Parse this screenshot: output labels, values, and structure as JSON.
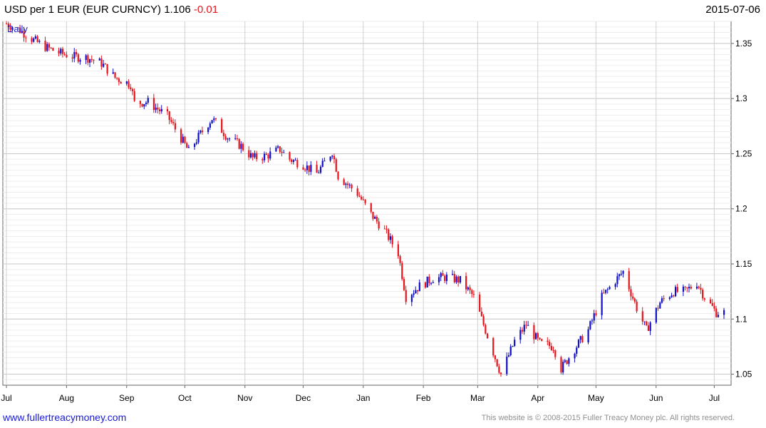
{
  "header": {
    "title": "USD per 1 EUR (EUR CURNCY) 1.106",
    "change": "-0.01",
    "date": "2015-07-06"
  },
  "footer": {
    "link": "www.fullertreacymoney.com",
    "copyright": "This website is © 2008-2015 Fuller Treacy Money plc. All rights reserved."
  },
  "colors": {
    "up": "#1010c8",
    "down": "#e8141c",
    "grid": "#dcdcdc",
    "axis": "#666666"
  },
  "chart_data": {
    "type": "candlestick",
    "period_label": "Daily",
    "ylim": [
      1.04,
      1.37
    ],
    "yticks": [
      1.05,
      1.1,
      1.15,
      1.2,
      1.25,
      1.3,
      1.35
    ],
    "ytick_labels": [
      "1.05",
      "1.1",
      "1.15",
      "1.2",
      "1.25",
      "1.3",
      "1.35"
    ],
    "xlim": [
      "2014-07-01",
      "2015-07-06"
    ],
    "months": [
      {
        "label": "Jul",
        "date": "2014-07-01"
      },
      {
        "label": "Aug",
        "date": "2014-08-01"
      },
      {
        "label": "Sep",
        "date": "2014-09-01"
      },
      {
        "label": "Oct",
        "date": "2014-10-01"
      },
      {
        "label": "Nov",
        "date": "2014-11-01"
      },
      {
        "label": "Dec",
        "date": "2014-12-01"
      },
      {
        "label": "Jan",
        "date": "2015-01-01"
      },
      {
        "label": "Feb",
        "date": "2015-02-01"
      },
      {
        "label": "Mar",
        "date": "2015-03-01"
      },
      {
        "label": "Apr",
        "date": "2015-04-01"
      },
      {
        "label": "May",
        "date": "2015-05-01"
      },
      {
        "label": "Jun",
        "date": "2015-06-01"
      },
      {
        "label": "Jul",
        "date": "2015-07-01"
      }
    ],
    "close_path": [
      [
        "2014-07-01",
        1.368
      ],
      [
        "2014-07-08",
        1.362
      ],
      [
        "2014-07-15",
        1.353
      ],
      [
        "2014-07-22",
        1.346
      ],
      [
        "2014-07-29",
        1.341
      ],
      [
        "2014-08-05",
        1.338
      ],
      [
        "2014-08-12",
        1.337
      ],
      [
        "2014-08-19",
        1.332
      ],
      [
        "2014-08-26",
        1.319
      ],
      [
        "2014-09-03",
        1.313
      ],
      [
        "2014-09-05",
        1.296
      ],
      [
        "2014-09-12",
        1.297
      ],
      [
        "2014-09-22",
        1.284
      ],
      [
        "2014-09-29",
        1.264
      ],
      [
        "2014-10-03",
        1.252
      ],
      [
        "2014-10-09",
        1.268
      ],
      [
        "2014-10-15",
        1.282
      ],
      [
        "2014-10-23",
        1.265
      ],
      [
        "2014-10-30",
        1.257
      ],
      [
        "2014-11-05",
        1.246
      ],
      [
        "2014-11-12",
        1.248
      ],
      [
        "2014-11-19",
        1.254
      ],
      [
        "2014-11-24",
        1.245
      ],
      [
        "2014-12-01",
        1.24
      ],
      [
        "2014-12-08",
        1.232
      ],
      [
        "2014-12-16",
        1.252
      ],
      [
        "2014-12-19",
        1.23
      ],
      [
        "2014-12-29",
        1.214
      ],
      [
        "2015-01-05",
        1.195
      ],
      [
        "2015-01-12",
        1.18
      ],
      [
        "2015-01-19",
        1.16
      ],
      [
        "2015-01-23",
        1.12
      ],
      [
        "2015-01-30",
        1.13
      ],
      [
        "2015-02-06",
        1.137
      ],
      [
        "2015-02-13",
        1.138
      ],
      [
        "2015-02-20",
        1.135
      ],
      [
        "2015-02-27",
        1.12
      ],
      [
        "2015-03-06",
        1.085
      ],
      [
        "2015-03-13",
        1.05
      ],
      [
        "2015-03-20",
        1.08
      ],
      [
        "2015-03-26",
        1.095
      ],
      [
        "2015-04-02",
        1.078
      ],
      [
        "2015-04-09",
        1.075
      ],
      [
        "2015-04-13",
        1.055
      ],
      [
        "2015-04-20",
        1.073
      ],
      [
        "2015-04-27",
        1.09
      ],
      [
        "2015-05-04",
        1.12
      ],
      [
        "2015-05-11",
        1.135
      ],
      [
        "2015-05-15",
        1.143
      ],
      [
        "2015-05-22",
        1.11
      ],
      [
        "2015-05-27",
        1.09
      ],
      [
        "2015-06-03",
        1.115
      ],
      [
        "2015-06-10",
        1.125
      ],
      [
        "2015-06-16",
        1.125
      ],
      [
        "2015-06-22",
        1.133
      ],
      [
        "2015-06-26",
        1.12
      ],
      [
        "2015-07-02",
        1.106
      ],
      [
        "2015-07-06",
        1.106
      ]
    ]
  }
}
